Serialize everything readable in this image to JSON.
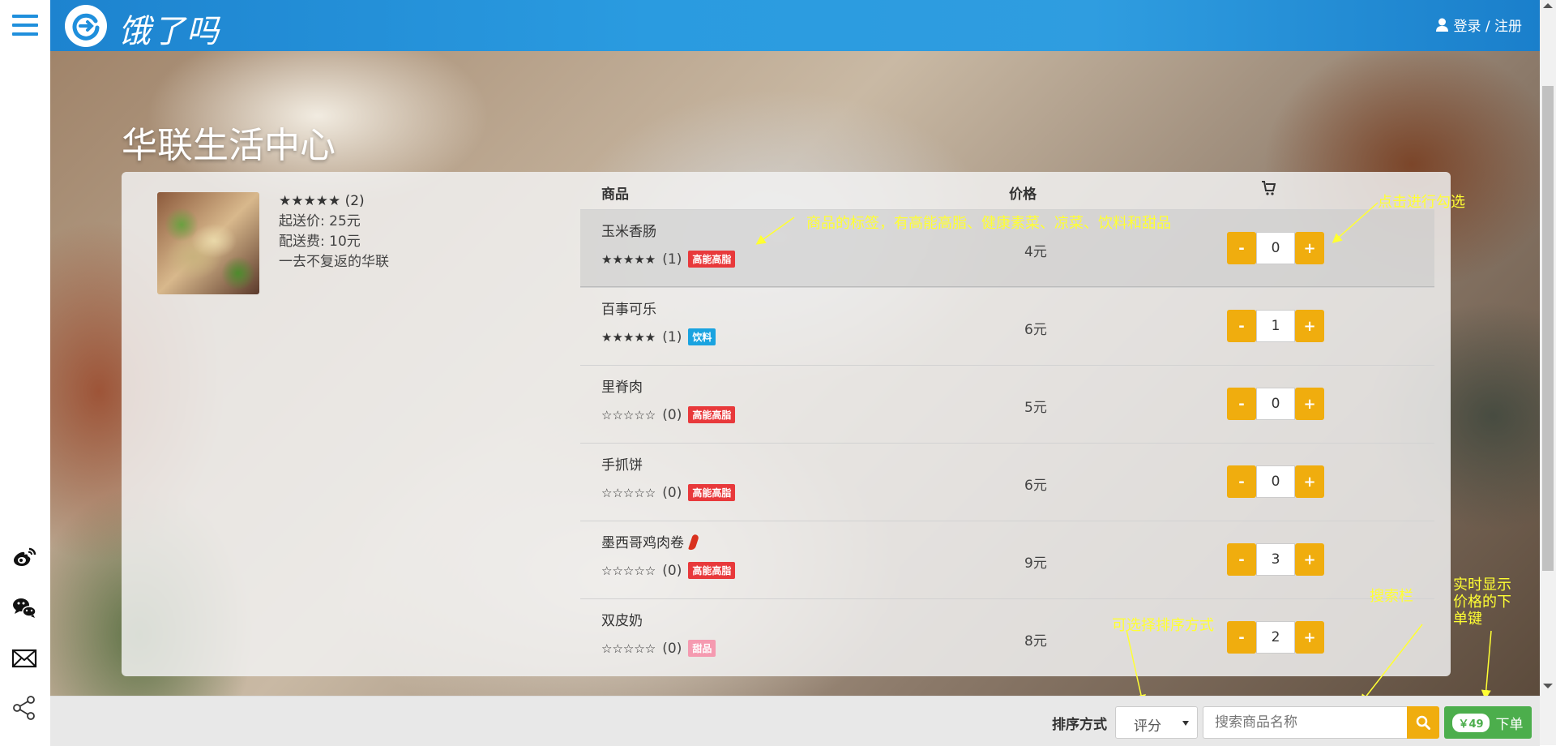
{
  "app": {
    "logo_text": "饿了吗",
    "login_label": "登录 / 注册"
  },
  "shop": {
    "name": "华联生活中心",
    "stars": "★★★★★",
    "rating_count": "(2)",
    "min_order": "起送价: 25元",
    "delivery_fee": "配送费: 10元",
    "slogan": "一去不复返的华联"
  },
  "menu": {
    "col_item": "商品",
    "col_price": "价格",
    "items": [
      {
        "name": "玉米香肠",
        "stars": "★★★★★",
        "count": "(1)",
        "tag": "高能高脂",
        "tag_color": "#e8393b",
        "price": "4元",
        "qty": "0",
        "hot": false
      },
      {
        "name": "百事可乐",
        "stars": "★★★★★",
        "count": "(1)",
        "tag": "饮料",
        "tag_color": "#1aa3e0",
        "price": "6元",
        "qty": "1",
        "hot": false
      },
      {
        "name": "里脊肉",
        "stars": "☆☆☆☆☆",
        "count": "(0)",
        "tag": "高能高脂",
        "tag_color": "#e8393b",
        "price": "5元",
        "qty": "0",
        "hot": false
      },
      {
        "name": "手抓饼",
        "stars": "☆☆☆☆☆",
        "count": "(0)",
        "tag": "高能高脂",
        "tag_color": "#e8393b",
        "price": "6元",
        "qty": "0",
        "hot": false
      },
      {
        "name": "墨西哥鸡肉卷",
        "stars": "☆☆☆☆☆",
        "count": "(0)",
        "tag": "高能高脂",
        "tag_color": "#e8393b",
        "price": "9元",
        "qty": "3",
        "hot": true
      },
      {
        "name": "双皮奶",
        "stars": "☆☆☆☆☆",
        "count": "(0)",
        "tag": "甜品",
        "tag_color": "#f59ab0",
        "price": "8元",
        "qty": "2",
        "hot": false
      }
    ],
    "minus_label": "-",
    "plus_label": "+"
  },
  "annotations": {
    "tags_note": "商品的标签，有高能高脂、健康素菜、凉菜、饮料和甜品",
    "select_note": "点击进行勾选",
    "sort_note": "可选择排序方式",
    "search_note": "搜索栏",
    "order_note_1": "实时显示",
    "order_note_2": "价格的下",
    "order_note_3": "单键"
  },
  "bottombar": {
    "sort_label": "排序方式",
    "sort_value": "评分",
    "search_placeholder": "搜索商品名称",
    "order_total": "￥49",
    "order_label": "下单"
  },
  "colors": {
    "header_blue": "#2a9be0",
    "accent_orange": "#f0ad0e",
    "order_green": "#4cae4c"
  }
}
